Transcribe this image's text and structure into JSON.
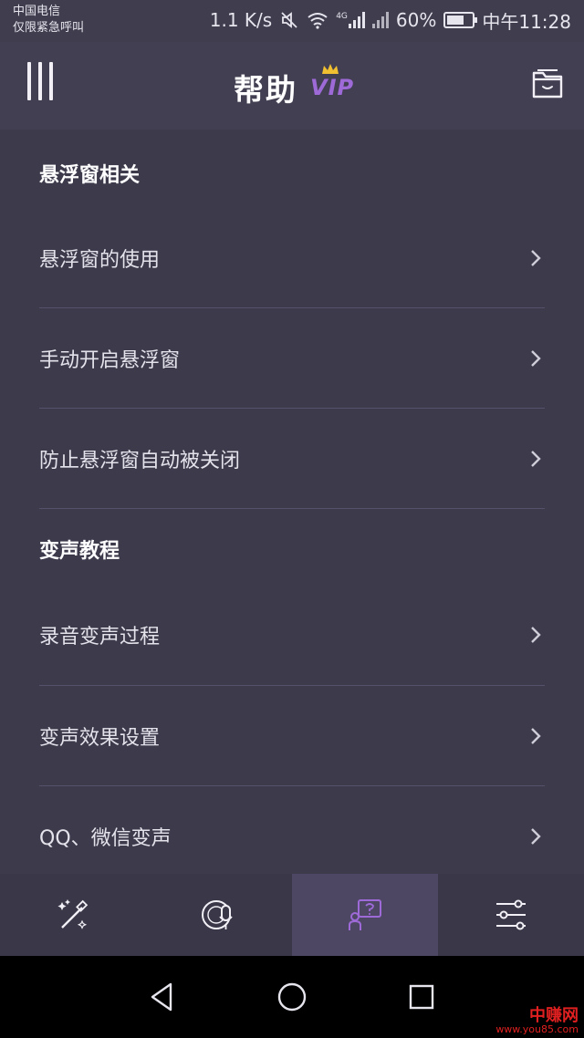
{
  "status_bar": {
    "carrier": "中国电信",
    "emergency": "仅限紧急呼叫",
    "speed": "1.1 K/s",
    "network": "4G",
    "battery": "60%",
    "time": "中午11:28"
  },
  "header": {
    "title": "帮助",
    "vip": "VIP"
  },
  "sections": [
    {
      "title": "悬浮窗相关",
      "items": [
        {
          "label": "悬浮窗的使用"
        },
        {
          "label": "手动开启悬浮窗"
        },
        {
          "label": "防止悬浮窗自动被关闭"
        }
      ]
    },
    {
      "title": "变声教程",
      "items": [
        {
          "label": "录音变声过程"
        },
        {
          "label": "变声效果设置"
        },
        {
          "label": "QQ、微信变声"
        }
      ]
    }
  ],
  "bottom_nav": [
    {
      "icon": "magic-wand-icon",
      "active": false
    },
    {
      "icon": "voice-record-icon",
      "active": false
    },
    {
      "icon": "help-icon",
      "active": true
    },
    {
      "icon": "settings-sliders-icon",
      "active": false
    }
  ],
  "watermark": {
    "brand": "中赚网",
    "url": "www.you85.com"
  },
  "colors": {
    "background": "#3d3a4c",
    "header": "#433f52",
    "accent": "#9d6ad8",
    "crown": "#f0c030",
    "active_tab": "#4d4763"
  }
}
